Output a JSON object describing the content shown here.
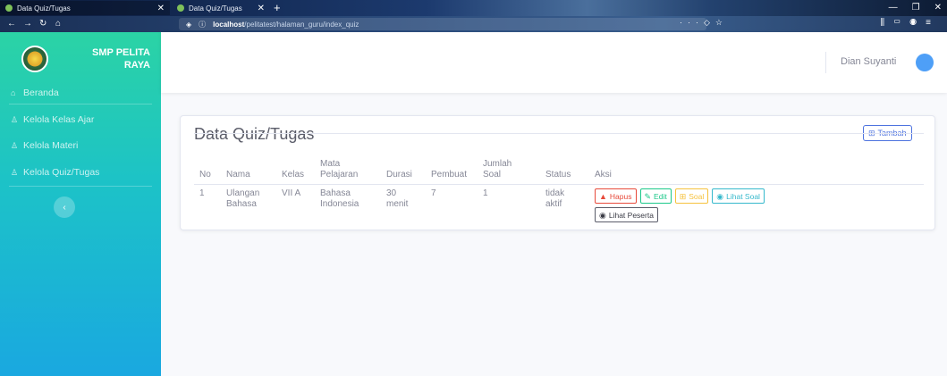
{
  "browser": {
    "tabs": [
      {
        "title": "Data Quiz/Tugas",
        "active": true
      },
      {
        "title": "Data Quiz/Tugas",
        "active": false
      }
    ],
    "url_host": "localhost",
    "url_path": "/pelitatest/halaman_guru/index_quiz"
  },
  "brand": {
    "line1": "SMP PELITA",
    "line2": "RAYA"
  },
  "sidebar": {
    "items": [
      {
        "label": "Beranda",
        "icon": "home-icon"
      },
      {
        "label": "Kelola Kelas Ajar",
        "icon": "user-icon"
      },
      {
        "label": "Kelola Materi",
        "icon": "user-icon"
      },
      {
        "label": "Kelola Quiz/Tugas",
        "icon": "user-icon"
      }
    ],
    "toggle_icon": "chevron-left-icon"
  },
  "topbar": {
    "user_name": "Dian Suyanti"
  },
  "card": {
    "title": "Data Quiz/Tugas",
    "add_label": "Tambah"
  },
  "table": {
    "columns": {
      "no": "No",
      "nama": "Nama",
      "kelas": "Kelas",
      "mapel_1": "Mata",
      "mapel_2": "Pelajaran",
      "durasi": "Durasi",
      "pembuat": "Pembuat",
      "jumlah_1": "Jumlah",
      "jumlah_2": "Soal",
      "status": "Status",
      "aksi": "Aksi"
    },
    "rows": [
      {
        "no": "1",
        "nama_1": "Ulangan",
        "nama_2": "Bahasa",
        "kelas": "VII A",
        "mapel_1": "Bahasa",
        "mapel_2": "Indonesia",
        "durasi_1": "30",
        "durasi_2": "menit",
        "pembuat": "7",
        "jumlah_soal": "1",
        "status_1": "tidak",
        "status_2": "aktif"
      }
    ],
    "actions": {
      "hapus": "Hapus",
      "edit": "Edit",
      "soal": "Soal",
      "lihat_soal": "Lihat Soal",
      "lihat_peserta": "Lihat Peserta"
    }
  },
  "colors": {
    "primary": "#4e73df",
    "danger": "#e74a3b",
    "success": "#1cc88a",
    "warning": "#f6c23e",
    "info": "#36b9cc"
  }
}
